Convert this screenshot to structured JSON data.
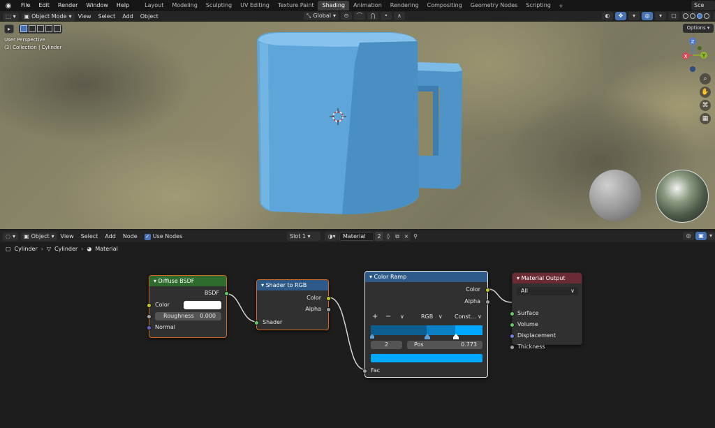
{
  "topbar": {
    "menus": [
      "File",
      "Edit",
      "Render",
      "Window",
      "Help"
    ],
    "workspaces": [
      "Layout",
      "Modeling",
      "Sculpting",
      "UV Editing",
      "Texture Paint",
      "Shading",
      "Animation",
      "Rendering",
      "Compositing",
      "Geometry Nodes",
      "Scripting"
    ],
    "active_workspace": "Shading",
    "add_tab": "+",
    "scene_label": "Sce"
  },
  "viewport_header": {
    "mode": "Object Mode",
    "menus": [
      "View",
      "Select",
      "Add",
      "Object"
    ],
    "orientation": "Global"
  },
  "viewport": {
    "view_name": "User Perspective",
    "collection_info": "(3) Collection | Cylinder",
    "options_label": "Options",
    "gizmo": {
      "z": "Z",
      "x": "X",
      "y": "Y"
    },
    "mug_color": "#5ea5d9"
  },
  "node_header": {
    "object_type": "Object",
    "menus": [
      "View",
      "Select",
      "Add",
      "Node"
    ],
    "use_nodes_label": "Use Nodes",
    "slot": "Slot 1",
    "material_name": "Material",
    "user_count": "2"
  },
  "breadcrumb": {
    "object": "Cylinder",
    "mesh": "Cylinder",
    "material": "Material"
  },
  "nodes": {
    "diffuse": {
      "title": "Diffuse BSDF",
      "output": "BSDF",
      "color_label": "Color",
      "roughness_label": "Roughness",
      "roughness_value": "0.000",
      "normal_label": "Normal",
      "header_color": "#2e6b2e"
    },
    "shader_to_rgb": {
      "title": "Shader to RGB",
      "out_color": "Color",
      "out_alpha": "Alpha",
      "in_shader": "Shader",
      "header_color": "#2e5a8a"
    },
    "color_ramp": {
      "title": "Color Ramp",
      "out_color": "Color",
      "out_alpha": "Alpha",
      "add": "+",
      "remove": "−",
      "menu": "∨",
      "color_mode": "RGB",
      "interpolation": "Const...",
      "stop_index": "2",
      "pos_label": "Pos",
      "pos_value": "0.773",
      "in_fac": "Fac",
      "ramp_colors": [
        "#0b5e8f",
        "#0b7fc4",
        "#00a8ff"
      ],
      "header_color": "#2e5a8a"
    },
    "material_output": {
      "title": "Material Output",
      "target": "All",
      "surface": "Surface",
      "volume": "Volume",
      "displacement": "Displacement",
      "thickness": "Thickness",
      "header_color": "#6b2b35"
    }
  }
}
